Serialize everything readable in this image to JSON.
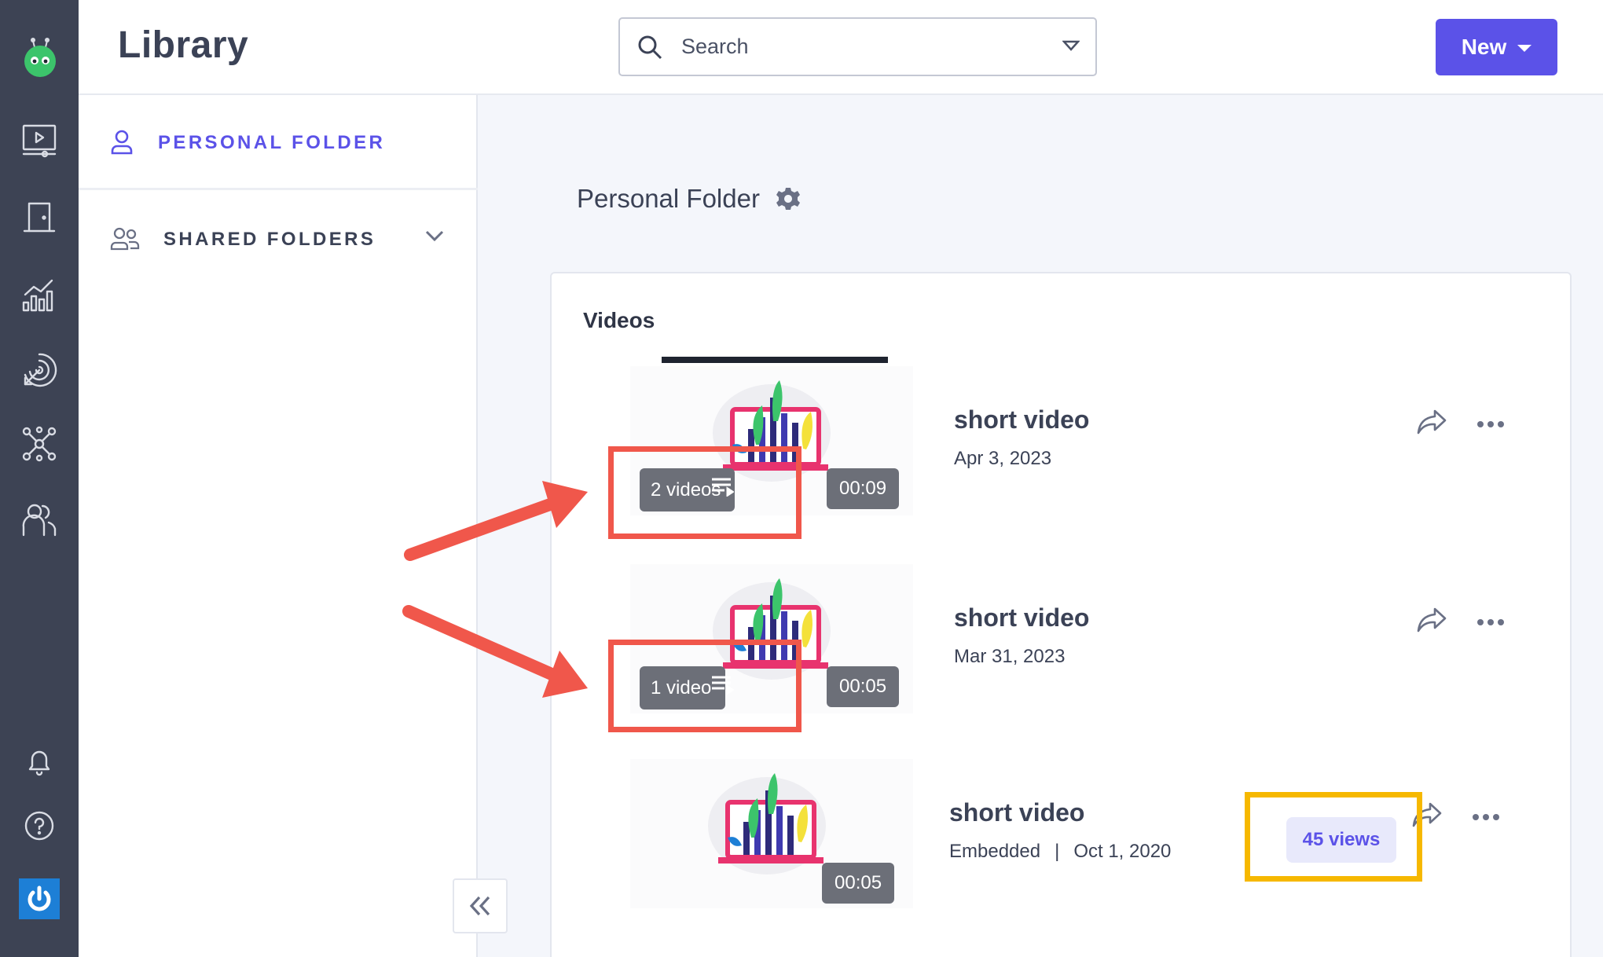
{
  "app": {
    "title": "Library"
  },
  "search": {
    "placeholder": "Search"
  },
  "new_button": {
    "label": "New"
  },
  "rail": {
    "icons": [
      "logo-icon",
      "videos-icon",
      "rooms-icon",
      "analytics-icon",
      "engagement-icon",
      "integrations-icon",
      "team-icon",
      "notifications-icon",
      "help-icon",
      "power-icon"
    ]
  },
  "folders": {
    "personal": "PERSONAL FOLDER",
    "shared": "SHARED FOLDERS"
  },
  "main": {
    "folder_title": "Personal Folder",
    "tab": "Videos"
  },
  "videos": [
    {
      "title": "short video",
      "date": "Apr 3, 2023",
      "playlist": "2 videos",
      "duration": "00:09"
    },
    {
      "title": "short video",
      "date": "Mar 31, 2023",
      "playlist": "1 video",
      "duration": "00:05"
    },
    {
      "title": "short video",
      "status": "Embedded",
      "separator": "|",
      "date": "Oct 1, 2020",
      "duration": "00:05",
      "views": "45 views"
    }
  ],
  "colors": {
    "accent": "#5b52e8",
    "rail": "#3d4354",
    "annotation_red": "#f0574b",
    "annotation_yellow": "#f6b800"
  }
}
